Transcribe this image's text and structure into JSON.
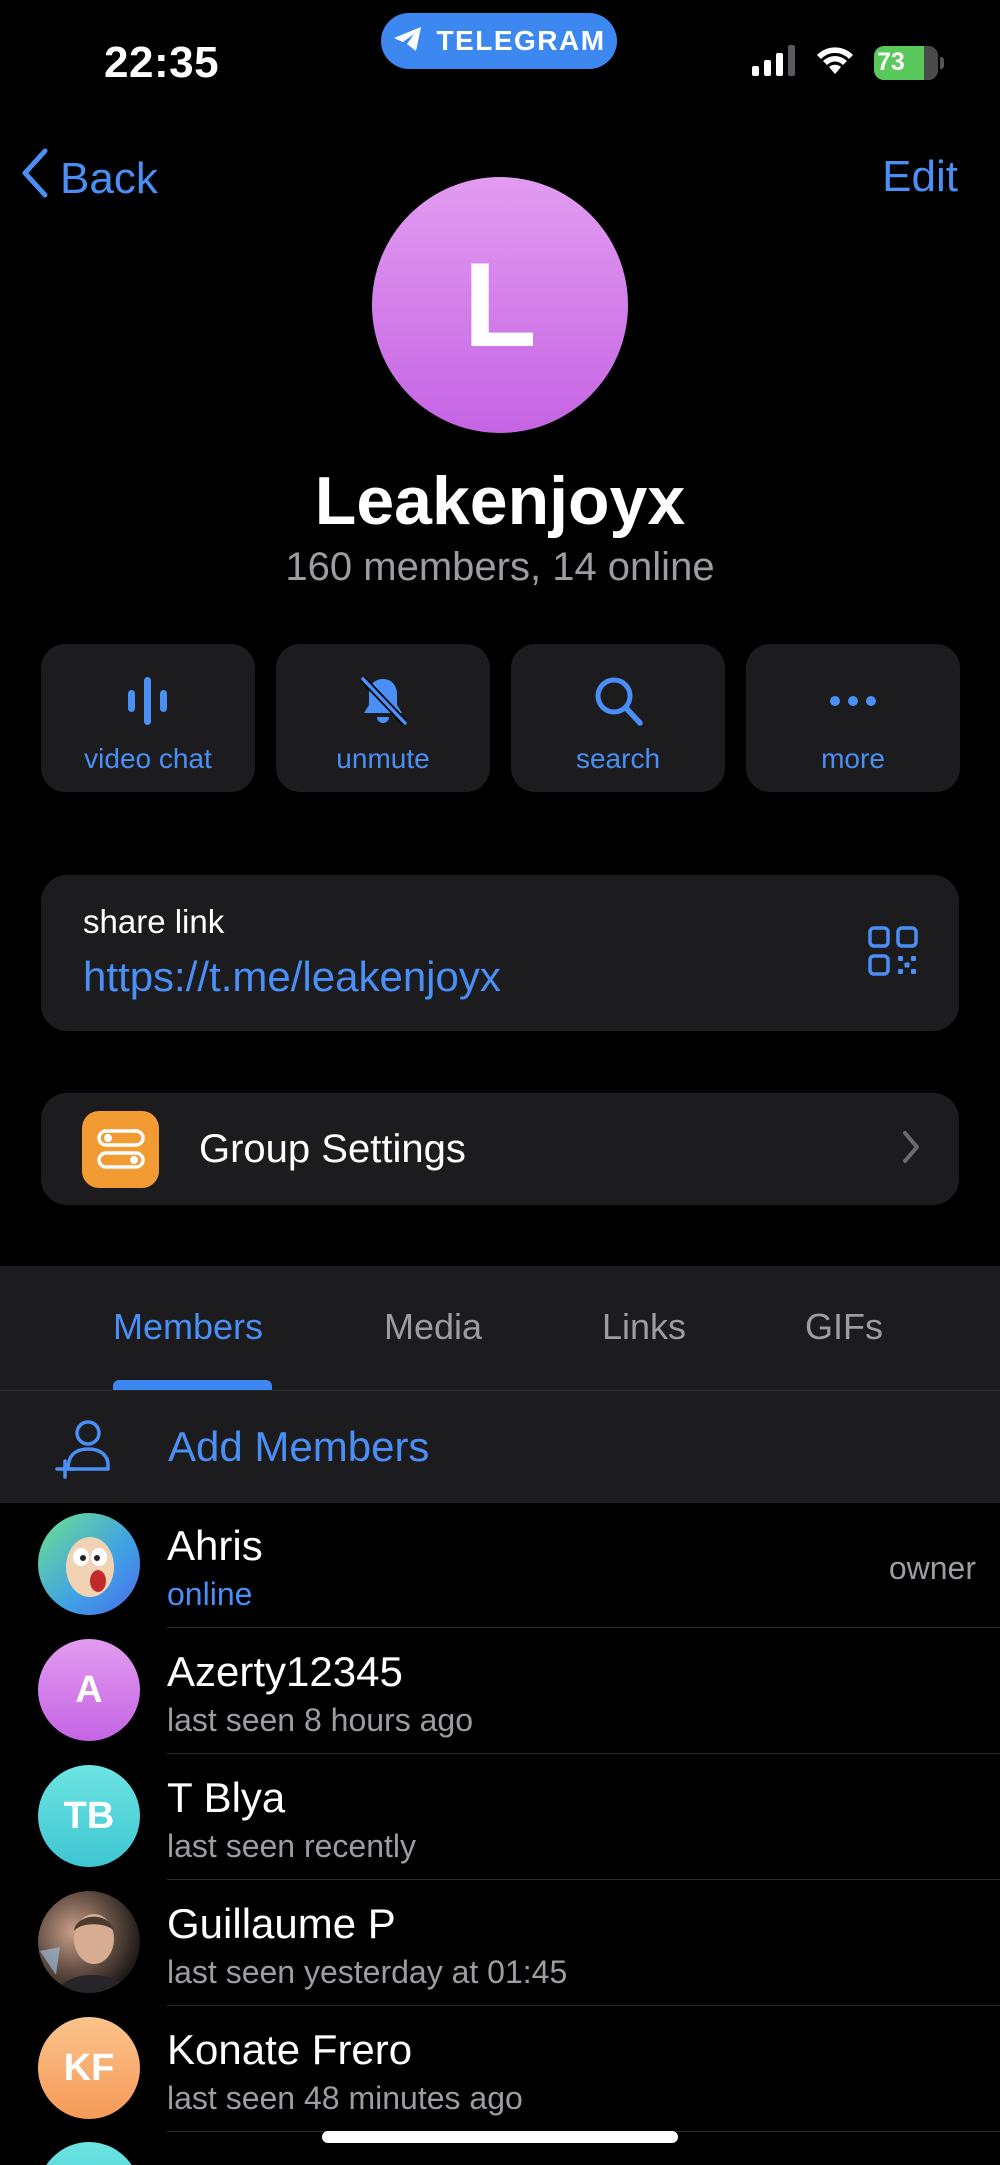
{
  "status_bar": {
    "time": "22:35",
    "app_pill": "TELEGRAM",
    "battery": "73",
    "colors": {
      "pill": "#3d88f0",
      "battery": "#5ac95b"
    }
  },
  "nav": {
    "back": "Back",
    "edit": "Edit"
  },
  "group": {
    "avatar_letter": "L",
    "name": "Leakenjoyx",
    "subtitle": "160 members, 14 online"
  },
  "actions": [
    {
      "label": "video chat",
      "icon": "voice-wave-icon"
    },
    {
      "label": "unmute",
      "icon": "bell-slash-icon"
    },
    {
      "label": "search",
      "icon": "magnifier-icon"
    },
    {
      "label": "more",
      "icon": "ellipsis-icon"
    }
  ],
  "share": {
    "title": "share link",
    "link": "https://t.me/leakenjoyx",
    "icon": "qr-code-icon"
  },
  "settings": {
    "label": "Group Settings",
    "icon": "sliders-icon"
  },
  "tabs": [
    {
      "label": "Members",
      "active": true
    },
    {
      "label": "Media",
      "active": false
    },
    {
      "label": "Links",
      "active": false
    },
    {
      "label": "GIFs",
      "active": false
    }
  ],
  "add_members": {
    "label": "Add Members",
    "icon": "add-user-icon"
  },
  "members": [
    {
      "name": "Ahris",
      "status": "online",
      "role": "owner",
      "initials": "",
      "avatar": "cartoon-face-photo"
    },
    {
      "name": "Azerty12345",
      "status": "last seen 8 hours ago",
      "role": "",
      "initials": "A",
      "avatar": "initials"
    },
    {
      "name": "T Blya",
      "status": "last seen recently",
      "role": "",
      "initials": "TB",
      "avatar": "initials"
    },
    {
      "name": "Guillaume P",
      "status": "last seen yesterday at 01:45",
      "role": "",
      "initials": "",
      "avatar": "person-photo"
    },
    {
      "name": "Konate Frero",
      "status": "last seen 48 minutes ago",
      "role": "",
      "initials": "KF",
      "avatar": "initials"
    }
  ],
  "theme": {
    "accent": "#4a8ff5",
    "card": "#1c1c1e",
    "muted": "#9c9ca1",
    "settings_badge": "#f39b33"
  }
}
